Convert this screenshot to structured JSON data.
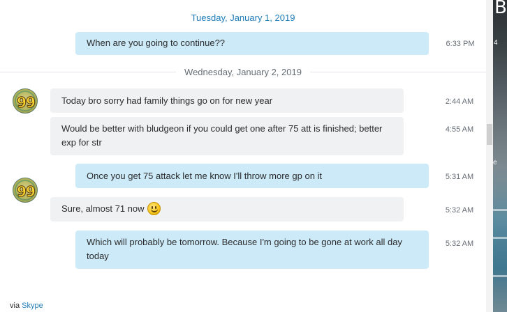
{
  "dates": {
    "first": "Tuesday, January 1, 2019",
    "second": "Wednesday, January 2, 2019"
  },
  "messages": [
    {
      "direction": "out",
      "text": "When are you going to continue??",
      "time": "6:33 PM"
    },
    {
      "direction": "in",
      "text": "Today bro sorry had family things go on for new year",
      "time": "2:44 AM",
      "avatar_label": "99"
    },
    {
      "direction": "in",
      "text": "Would be better with bludgeon if you could get one after 75 att is finished; better exp for str",
      "time": "4:55 AM"
    },
    {
      "direction": "out",
      "text": "Once you get 75 attack let me know I'll throw more gp on it",
      "time": "5:31 AM"
    },
    {
      "direction": "in",
      "text": "Sure, almost 71 now",
      "time": "5:32 AM",
      "avatar_label": "99",
      "emoji": "smile-emoji"
    },
    {
      "direction": "out",
      "text": "Which will probably be tomorrow. Because I'm going to be gone at work all day today",
      "time": "5:32 AM"
    }
  ],
  "footer": {
    "prefix": "via",
    "link": "Skype"
  },
  "desktop": {
    "frag1": "B",
    "frag2": "4",
    "frag3": "e"
  },
  "colors": {
    "incoming_bubble": "#f0f1f3",
    "outgoing_bubble": "#cdeaf9",
    "date_accent": "#1f7cb8",
    "link": "#1f7cb8"
  }
}
